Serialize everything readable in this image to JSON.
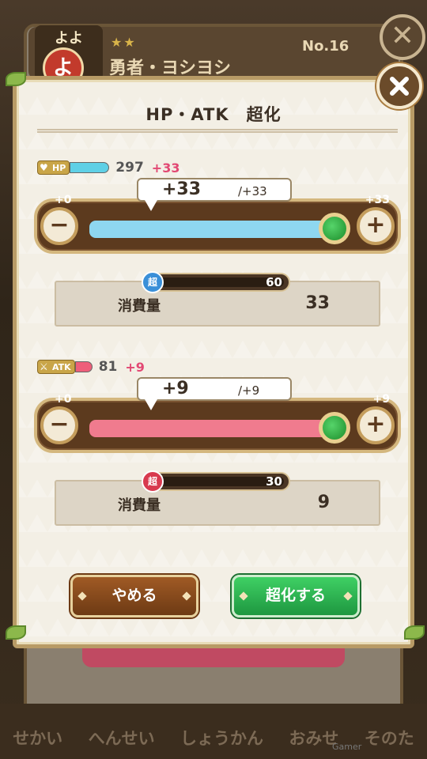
{
  "background": {
    "badge_text": "よよ",
    "badge_char": "よ",
    "rarity_stars": "★★",
    "hero_name": "勇者・ヨシヨシ",
    "hero_number": "No.16",
    "nav_items": [
      "せかい",
      "へんせい",
      "しょうかん",
      "おみせ",
      "そのた"
    ],
    "watermark": "Gamer"
  },
  "dialog": {
    "title": "HP・ATK　超化",
    "hp": {
      "tag_label": "HP",
      "tag_color": "#5fd0e6",
      "current_value": "297",
      "bonus_text": "+33",
      "range_min": "+0",
      "range_max": "+33",
      "selected_text": "+33",
      "selected_max_text": "/+33",
      "slider_fraction": 1.0,
      "fill_color": "#8ed7f0",
      "material_badge": "超",
      "material_color": "#3a8fd8",
      "material_count": "60",
      "cost_label": "消費量",
      "cost_value": "33"
    },
    "atk": {
      "tag_label": "ATK",
      "tag_color": "#ee5e7a",
      "current_value": "81",
      "bonus_text": "+9",
      "range_min": "+0",
      "range_max": "+9",
      "selected_text": "+9",
      "selected_max_text": "/+9",
      "slider_fraction": 1.0,
      "fill_color": "#f07b8e",
      "material_badge": "超",
      "material_color": "#d83a4f",
      "material_count": "30",
      "cost_label": "消費量",
      "cost_value": "9"
    },
    "buttons": {
      "cancel_label": "やめる",
      "confirm_label": "超化する"
    }
  }
}
